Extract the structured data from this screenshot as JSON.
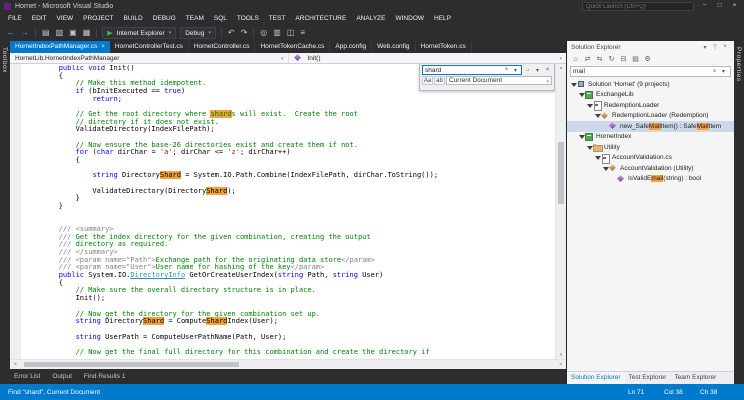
{
  "window": {
    "title": "Hornet - Microsoft Visual Studio",
    "quick_launch_placeholder": "Quick Launch (Ctrl+Q)",
    "minimize_glyph": "−",
    "maximize_glyph": "□",
    "close_glyph": "×"
  },
  "menu": [
    "FILE",
    "EDIT",
    "VIEW",
    "PROJECT",
    "BUILD",
    "DEBUG",
    "TEAM",
    "SQL",
    "TOOLS",
    "TEST",
    "ARCHITECTURE",
    "ANALYZE",
    "WINDOW",
    "HELP"
  ],
  "toolbar": {
    "icons_left": [
      {
        "name": "nav-back-icon",
        "glyph": "←",
        "blue": true
      },
      {
        "name": "nav-forward-icon",
        "glyph": "→",
        "blue": true
      },
      {
        "name": "separator"
      },
      {
        "name": "new-file-icon",
        "glyph": "▤"
      },
      {
        "name": "open-file-icon",
        "glyph": "▧"
      },
      {
        "name": "save-icon",
        "glyph": "▣"
      },
      {
        "name": "save-all-icon",
        "glyph": "▦"
      },
      {
        "name": "separator"
      }
    ],
    "run_play_glyph": "▶",
    "run_target": "Internet Explorer",
    "configuration": "Debug",
    "icons_right": [
      {
        "name": "separator"
      },
      {
        "name": "undo-icon",
        "glyph": "↶"
      },
      {
        "name": "redo-icon",
        "glyph": "↷"
      },
      {
        "name": "separator"
      },
      {
        "name": "find-in-files-icon",
        "glyph": "◎"
      },
      {
        "name": "comment-icon",
        "glyph": "▥"
      },
      {
        "name": "uncomment-icon",
        "glyph": "◫"
      },
      {
        "name": "outline-icon",
        "glyph": "≡"
      }
    ]
  },
  "doc_tabs": [
    {
      "label": "HornetIndexPathManager.cs",
      "active": true
    },
    {
      "label": "HornetControllerTest.cs"
    },
    {
      "label": "HornetController.cs"
    },
    {
      "label": "HornetTokenCache.cs"
    },
    {
      "label": "App.config"
    },
    {
      "label": "Web.config"
    },
    {
      "label": "HornetToken.cs"
    }
  ],
  "navbar": {
    "type_dropdown": "HornetLib.HornetIndexPathManager",
    "member_dropdown": "Init()",
    "chevron": "▾"
  },
  "find_panel": {
    "query": "shard",
    "clear_glyph": "×",
    "history_glyph": "▾",
    "find_next_glyph": "→",
    "options_glyph": "▾",
    "close_glyph": "×",
    "match_case_label": "Aa",
    "whole_word_label": "ab",
    "scope": "Current Document"
  },
  "editor": {
    "lines": [
      [
        [
          "        ",
          "n"
        ],
        [
          "public",
          "k"
        ],
        [
          " ",
          "n"
        ],
        [
          "void",
          "k"
        ],
        [
          " Init()",
          "n"
        ]
      ],
      [
        [
          "        {",
          "n"
        ]
      ],
      [
        [
          "            ",
          "n"
        ],
        [
          "// Make this method idempotent.",
          "c"
        ]
      ],
      [
        [
          "            ",
          "n"
        ],
        [
          "if",
          "k"
        ],
        [
          " (bInitExecuted == ",
          "n"
        ],
        [
          "true",
          "k"
        ],
        [
          ")",
          "n"
        ]
      ],
      [
        [
          "                ",
          "n"
        ],
        [
          "return",
          "k"
        ],
        [
          ";",
          "n"
        ]
      ],
      [],
      [
        [
          "            ",
          "n"
        ],
        [
          "// Get the root directory where ",
          "c"
        ],
        [
          "shard",
          "c h"
        ],
        [
          "s will exist.  Create the root",
          "c"
        ]
      ],
      [
        [
          "            ",
          "n"
        ],
        [
          "// directory if it does not exist.",
          "c"
        ]
      ],
      [
        [
          "            ValidateDirectory(IndexFilePath);",
          "n"
        ]
      ],
      [],
      [
        [
          "            ",
          "n"
        ],
        [
          "// Now ensure the base-26 directories exist and create them if not.",
          "c"
        ]
      ],
      [
        [
          "            ",
          "n"
        ],
        [
          "for",
          "k"
        ],
        [
          " (",
          "n"
        ],
        [
          "char",
          "k"
        ],
        [
          " dirChar = ",
          "n"
        ],
        [
          "'a'",
          "s"
        ],
        [
          "; dirChar <= ",
          "n"
        ],
        [
          "'z'",
          "s"
        ],
        [
          "; dirChar++)",
          "n"
        ]
      ],
      [
        [
          "            {",
          "n"
        ]
      ],
      [],
      [
        [
          "                ",
          "n"
        ],
        [
          "string",
          "k"
        ],
        [
          " Directory",
          "n"
        ],
        [
          "Shard",
          "h"
        ],
        [
          " = System.IO.Path.Combine(IndexFilePath, dirChar.ToString());",
          "n"
        ]
      ],
      [],
      [
        [
          "                ValidateDirectory(Directory",
          "n"
        ],
        [
          "Shard",
          "h"
        ],
        [
          ");",
          "n"
        ]
      ],
      [
        [
          "            }",
          "n"
        ]
      ],
      [
        [
          "        }",
          "n"
        ]
      ],
      [],
      [],
      [
        [
          "        ",
          "n"
        ],
        [
          "/// <summary>",
          "g"
        ]
      ],
      [
        [
          "        ",
          "n"
        ],
        [
          "/// ",
          "g"
        ],
        [
          "Get the index directory for the given combination, creating the output",
          "dc"
        ]
      ],
      [
        [
          "        ",
          "n"
        ],
        [
          "/// ",
          "g"
        ],
        [
          "directory as required.",
          "dc"
        ]
      ],
      [
        [
          "        ",
          "n"
        ],
        [
          "/// </summary>",
          "g"
        ]
      ],
      [
        [
          "        ",
          "n"
        ],
        [
          "/// <param name=\"Path\">",
          "g"
        ],
        [
          "Exchange path for the originating data store",
          "dc"
        ],
        [
          "</param>",
          "g"
        ]
      ],
      [
        [
          "        ",
          "n"
        ],
        [
          "/// <param name=\"User\">",
          "g"
        ],
        [
          "User name for hashing of the key",
          "dc"
        ],
        [
          "</param>",
          "g"
        ]
      ],
      [
        [
          "        ",
          "n"
        ],
        [
          "public",
          "k"
        ],
        [
          " System.IO.",
          "n"
        ],
        [
          "DirectoryInfo",
          "t"
        ],
        [
          " GetOrCreateUserIndex(",
          "n"
        ],
        [
          "string",
          "k"
        ],
        [
          " Path, ",
          "n"
        ],
        [
          "string",
          "k"
        ],
        [
          " User)",
          "n"
        ]
      ],
      [
        [
          "        {",
          "n"
        ]
      ],
      [
        [
          "            ",
          "n"
        ],
        [
          "// Make sure the overall directory structure is in place.",
          "c"
        ]
      ],
      [
        [
          "            Init();",
          "n"
        ]
      ],
      [],
      [
        [
          "            ",
          "n"
        ],
        [
          "// Now get the directory for the given combination set up.",
          "c"
        ]
      ],
      [
        [
          "            ",
          "n"
        ],
        [
          "string",
          "k"
        ],
        [
          " Directory",
          "n"
        ],
        [
          "Shard",
          "h"
        ],
        [
          " = Compute",
          "n"
        ],
        [
          "Shard",
          "h"
        ],
        [
          "Index(User);",
          "n"
        ]
      ],
      [],
      [
        [
          "            ",
          "n"
        ],
        [
          "string",
          "k"
        ],
        [
          " UserPath = ComputeUserPathName(Path, User);",
          "n"
        ]
      ],
      [],
      [
        [
          "            ",
          "n"
        ],
        [
          "// Now get the final full directory for this combination and create the directory if",
          "c"
        ]
      ]
    ]
  },
  "solution_explorer": {
    "title": "Solution Explorer",
    "header_icons": [
      {
        "name": "window-options-icon",
        "glyph": "▾"
      },
      {
        "name": "pin-icon",
        "glyph": "⊤"
      },
      {
        "name": "close-icon",
        "glyph": "×"
      }
    ],
    "toolbar_icons": [
      {
        "name": "home-icon",
        "glyph": "⌂"
      },
      {
        "name": "switch-views-icon",
        "glyph": "⇄"
      },
      {
        "name": "sync-active-document-icon",
        "glyph": "⇆"
      },
      {
        "name": "refresh-icon",
        "glyph": "↻"
      },
      {
        "name": "collapse-all-icon",
        "glyph": "⊟"
      },
      {
        "name": "show-all-files-icon",
        "glyph": "▤"
      },
      {
        "name": "properties-icon",
        "glyph": "⚙"
      }
    ],
    "search_text": "mail",
    "search_clear_glyph": "×",
    "search_options_glyph": "▾",
    "tree": [
      {
        "level": 0,
        "icon": "icon-solution-icon",
        "expanded": true,
        "segments": [
          [
            "Solution 'Hornet' (9 projects)",
            "n"
          ]
        ]
      },
      {
        "level": 1,
        "icon": "icon-csproject-icon",
        "expanded": true,
        "segments": [
          [
            "ExchangeLib",
            "n"
          ]
        ]
      },
      {
        "level": 2,
        "icon": "icon-csfile-icon",
        "expanded": true,
        "segments": [
          [
            "RedemptionLoader",
            "n"
          ]
        ]
      },
      {
        "level": 3,
        "icon": "icon-class-icon",
        "expanded": true,
        "segments": [
          [
            "RedemptionLoader (Redemption)",
            "n"
          ]
        ]
      },
      {
        "level": 4,
        "icon": "icon-method-icon",
        "expanded": false,
        "selected": true,
        "segments": [
          [
            "new_Safe",
            "n"
          ],
          [
            "Mail",
            "h"
          ],
          [
            "Item() : Safe",
            "n"
          ],
          [
            "Mail",
            "h"
          ],
          [
            "Item",
            "n"
          ]
        ]
      },
      {
        "level": 1,
        "icon": "icon-csproject-icon",
        "expanded": true,
        "segments": [
          [
            "HornetIndex",
            "n"
          ]
        ]
      },
      {
        "level": 2,
        "icon": "icon-folder-icon",
        "expanded": true,
        "segments": [
          [
            "Utility",
            "n"
          ]
        ]
      },
      {
        "level": 3,
        "icon": "icon-csfile-icon",
        "expanded": true,
        "segments": [
          [
            "AccountValidation.cs",
            "n"
          ]
        ]
      },
      {
        "level": 4,
        "icon": "icon-class-icon",
        "expanded": true,
        "segments": [
          [
            "AccountValidation (Utility)",
            "n"
          ]
        ]
      },
      {
        "level": 5,
        "icon": "icon-method-icon",
        "expanded": false,
        "segments": [
          [
            "IsValidE",
            "n"
          ],
          [
            "mail",
            "h"
          ],
          [
            "(string) : bool",
            "n"
          ]
        ]
      }
    ],
    "panel_tabs": [
      {
        "label": "Solution Explorer",
        "active": true
      },
      {
        "label": "Test Explorer"
      },
      {
        "label": "Team Explorer"
      }
    ]
  },
  "side_strips": {
    "left": "Toolbox",
    "right": "Properties"
  },
  "bottom_panel_tabs": [
    "Error List",
    "Output",
    "Find Results 1"
  ],
  "status_bar": {
    "message": "Find \"shard\", Current Document",
    "line": "Ln 71",
    "column": "Col 38",
    "character": "Ch 38",
    "accent_color": "#007ACC"
  },
  "highlight_color": "#F2A33C"
}
